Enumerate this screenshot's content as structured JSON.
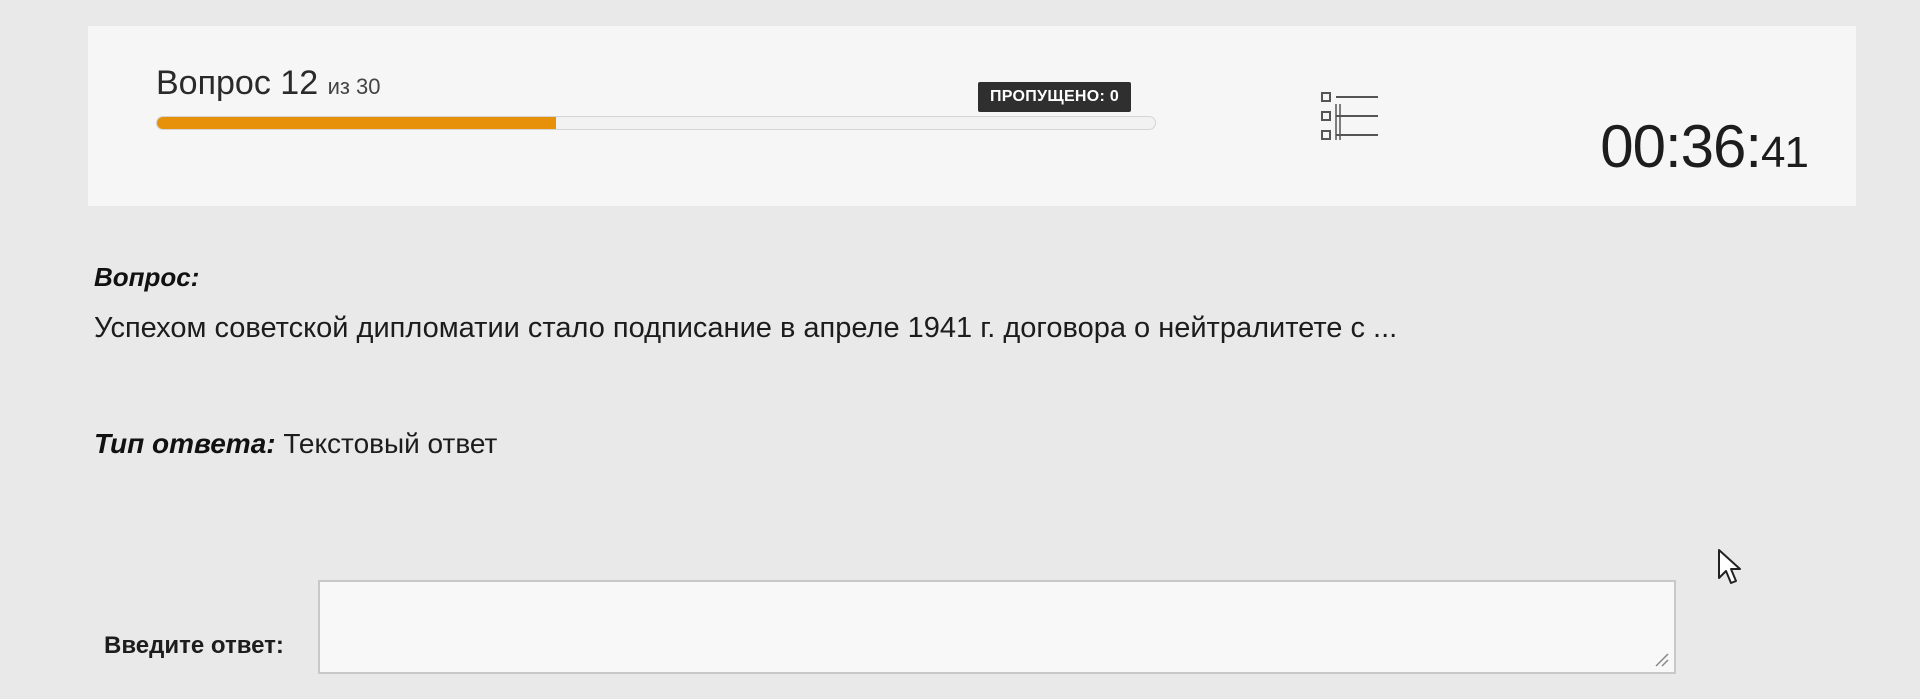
{
  "header": {
    "question_word": "Вопрос",
    "question_number": "12",
    "question_of_total": "из 30",
    "progress_fraction": 0.4,
    "skipped_label": "ПРОПУЩЕНО: 0",
    "list_icon": "question-list-icon",
    "timer_main": "00:36:",
    "timer_seconds": "41"
  },
  "question": {
    "label": "Вопрос:",
    "text": "Успехом советской дипломатии стало подписание в апреле 1941 г. договора о нейтралитете с ..."
  },
  "answer_type": {
    "label": "Тип ответа:",
    "value": "Текстовый ответ"
  },
  "answer": {
    "label": "Введите ответ:",
    "value": ""
  },
  "colors": {
    "accent": "#e7900a",
    "badge_bg": "#2f2f2f",
    "panel_bg": "#f6f6f6",
    "page_bg": "#e9e9e9"
  }
}
